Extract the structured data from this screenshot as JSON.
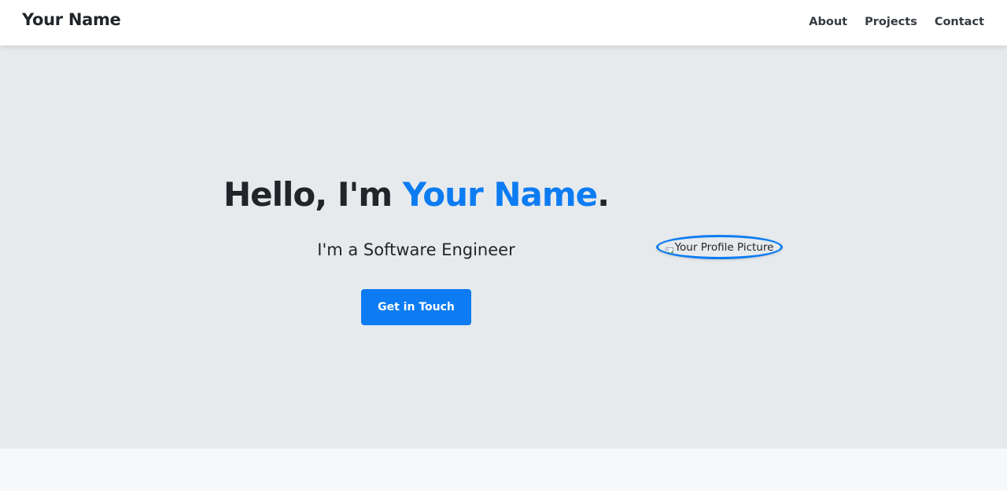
{
  "navbar": {
    "brand": "Your Name",
    "links": [
      {
        "label": "About"
      },
      {
        "label": "Projects"
      },
      {
        "label": "Contact"
      }
    ]
  },
  "hero": {
    "greeting": "Hello, I'm ",
    "name": "Your Name",
    "punctuation": ".",
    "subtitle": "I'm a Software Engineer",
    "cta_label": "Get in Touch",
    "profile_alt": "Your Profile Picture"
  },
  "colors": {
    "accent": "#0d7cf2",
    "hero_bg": "#e7eaed",
    "text": "#212529",
    "navbar_bg": "#ffffff"
  },
  "icons": {
    "broken_image": "broken-image-icon"
  }
}
